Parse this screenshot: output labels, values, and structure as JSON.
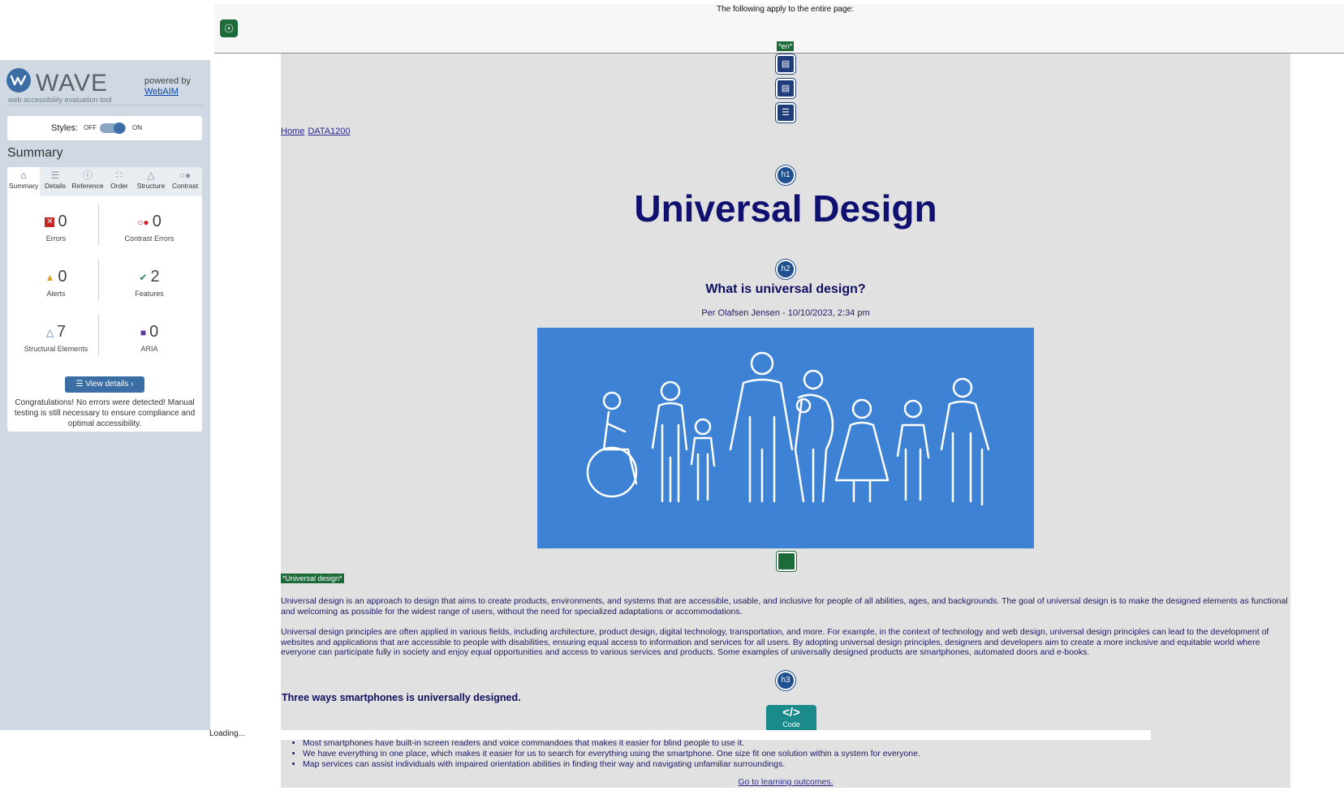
{
  "wave": {
    "logo_text": "WAVE",
    "subtitle": "web accessibility evaluation tool",
    "powered_by": "powered by",
    "webaim": "WebAIM",
    "styles_label": "Styles:",
    "styles_off": "OFF",
    "styles_on": "ON",
    "summary_title": "Summary",
    "tabs": [
      {
        "label": "Summary",
        "icon": "home-icon"
      },
      {
        "label": "Details",
        "icon": "list-icon"
      },
      {
        "label": "Reference",
        "icon": "info-icon"
      },
      {
        "label": "Order",
        "icon": "order-icon"
      },
      {
        "label": "Structure",
        "icon": "structure-icon"
      },
      {
        "label": "Contrast",
        "icon": "contrast-icon"
      }
    ],
    "stats": {
      "errors": {
        "value": "0",
        "label": "Errors",
        "color": "#c62828"
      },
      "contrast": {
        "value": "0",
        "label": "Contrast Errors",
        "color": "#c62828"
      },
      "alerts": {
        "value": "0",
        "label": "Alerts",
        "color": "#e0a020"
      },
      "features": {
        "value": "2",
        "label": "Features",
        "color": "#2e8b57"
      },
      "structural": {
        "value": "7",
        "label": "Structural Elements",
        "color": "#3a6ea5"
      },
      "aria": {
        "value": "0",
        "label": "ARIA",
        "color": "#5b3a9a"
      }
    },
    "view_details": "View details ›",
    "congrats": "Congratulations! No errors were detected! Manual testing is still necessary to ensure compliance and optimal accessibility."
  },
  "topbar": {
    "message": "The following apply to the entire page:",
    "lang_tag": "*en*"
  },
  "page": {
    "breadcrumb": [
      "Home",
      "DATA1200"
    ],
    "h1_badge": "h1",
    "h2_badge": "h2",
    "h3_badge": "h3",
    "title": "Universal Design",
    "subtitle": "What is universal design?",
    "byline": "Per Olafsen Jensen - 10/10/2023, 2:34 pm",
    "alt_tag": "*Universal design*",
    "paragraph1": "Universal design is an approach to design that aims to create products, environments, and systems that are accessible, usable, and inclusive for people of all abilities, ages, and backgrounds. The goal of universal design is to make the designed elements as functional and welcoming as possible for the widest range of users, without the need for specialized adaptations or accommodations.",
    "paragraph2": "Universal design principles are often applied in various fields, including architecture, product design, digital technology, transportation, and more. For example, in the context of technology and web design, universal design principles can lead to the development of websites and applications that are accessible to people with disabilities, ensuring equal access to information and services for all users. By adopting universal design principles, designers and developers aim to create a more inclusive and equitable world where everyone can participate fully in society and enjoy equal opportunities and access to various services and products. Some examples of universally designed products are smartphones, automated doors and e-books.",
    "heading3": "Three ways smartphones is universally designed.",
    "code_label": "Code",
    "list": [
      "Most smartphones have built-in screen readers and voice commandoes that makes it easier for blind people to use it.",
      "We have everything in one place, which makes it easier for us to search for everything using the smartphone. One size fit one solution within a system for everyone.",
      "Map services can assist individuals with impaired orientation abilities in finding their way and navigating unfamiliar surroundings."
    ],
    "goto_link": "Go to learning outcomes."
  },
  "status": {
    "loading": "Loading..."
  }
}
